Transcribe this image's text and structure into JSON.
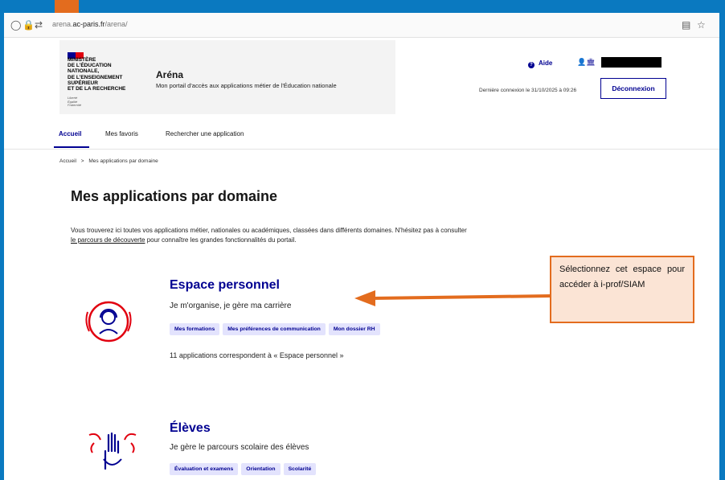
{
  "browser": {
    "url_prefix": "arena.",
    "url_domain": "ac-paris.fr",
    "url_path": "/arena/"
  },
  "header": {
    "ministry_lines": [
      "MINISTÈRE",
      "DE L'ÉDUCATION",
      "NATIONALE,",
      "DE L'ENSEIGNEMENT",
      "SUPÉRIEUR",
      "ET DE LA RECHERCHE"
    ],
    "devise": [
      "Liberté",
      "Égalité",
      "Fraternité"
    ],
    "app_title": "Aréna",
    "app_subtitle": "Mon portail d'accès aux applications métier de l'Éducation nationale",
    "aide_label": "Aide",
    "last_login": "Dernière connexion le 31/10/2025 à 09:26",
    "logout_label": "Déconnexion"
  },
  "nav": {
    "items": [
      "Accueil",
      "Mes favoris",
      "Rechercher une application"
    ]
  },
  "breadcrumb": {
    "home": "Accueil",
    "separator": ">",
    "current": "Mes applications par domaine"
  },
  "main": {
    "title": "Mes applications par domaine",
    "intro_text": "Vous trouverez ici toutes vos applications métier, nationales ou académiques, classées dans différents domaines. N'hésitez pas à consulter",
    "intro_link": "le parcours de découverte",
    "intro_end": "pour connaître les grandes fonctionnalités du portail."
  },
  "domains": [
    {
      "title": "Espace personnel",
      "subtitle": "Je m'organise, je gère ma carrière",
      "tags": [
        "Mes formations",
        "Mes préférences de communication",
        "Mon dossier RH"
      ],
      "count_text": "11 applications correspondent à « Espace personnel »"
    },
    {
      "title": "Élèves",
      "subtitle": "Je gère le parcours scolaire des élèves",
      "tags": [
        "Évaluation et examens",
        "Orientation",
        "Scolarité"
      ]
    }
  ],
  "annotation": {
    "text": "Sélectionnez cet espace pour accéder à i-prof/SIAM"
  },
  "colors": {
    "accent": "#000091",
    "annotation_border": "#e36c1e",
    "annotation_bg": "#fbe4d5",
    "icon_red": "#e1000f",
    "background_frame": "#0a79c0"
  }
}
